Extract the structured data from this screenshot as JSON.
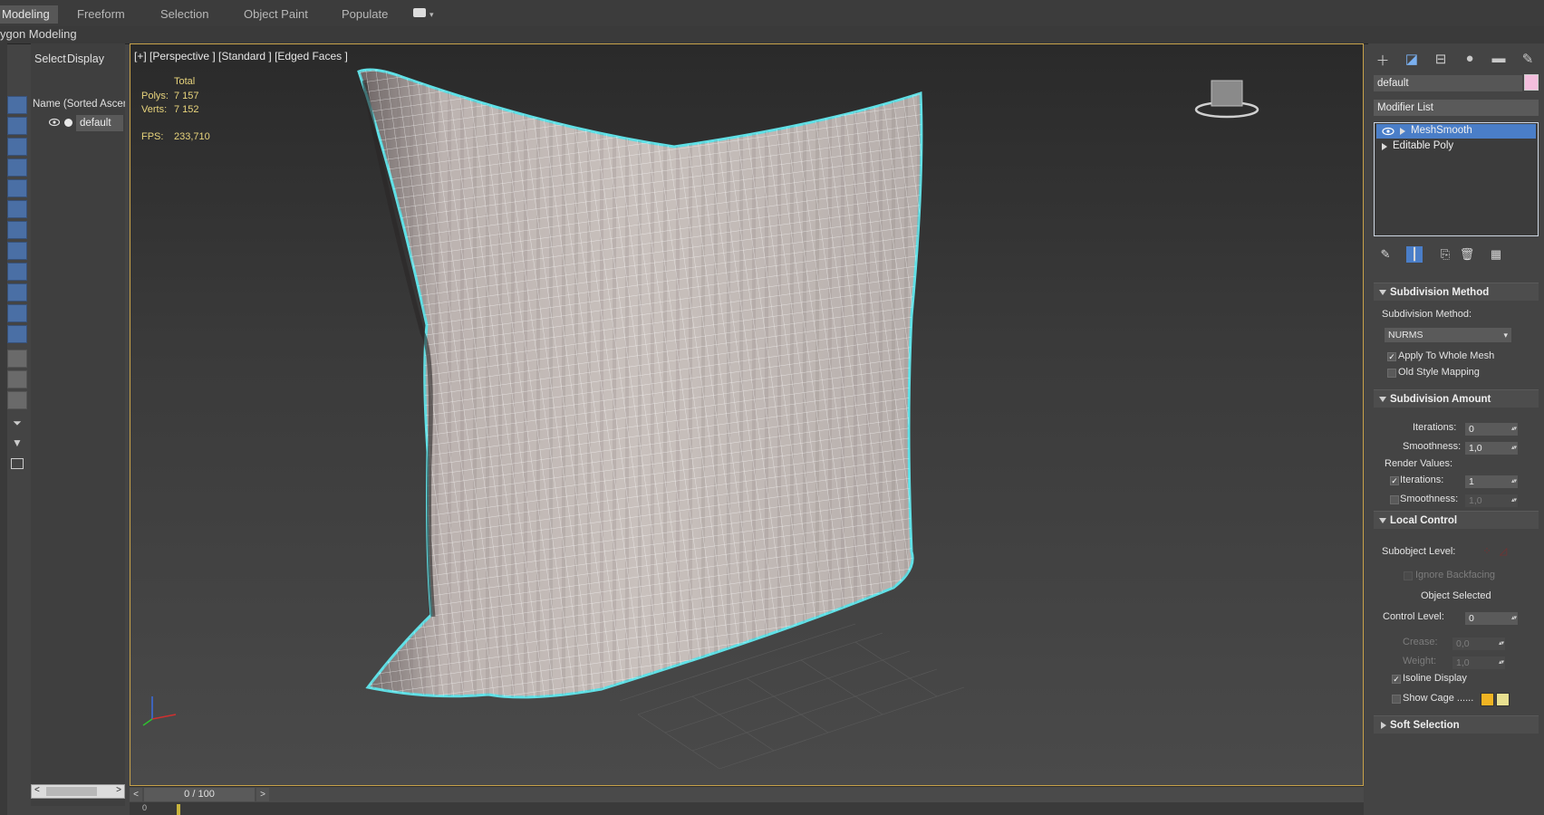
{
  "ribbon": {
    "tabs": [
      "Modeling",
      "Freeform",
      "Selection",
      "Object Paint",
      "Populate"
    ],
    "subtitle": "ygon Modeling"
  },
  "explorer": {
    "tab_select": "Select",
    "tab_display": "Display",
    "column_header": "Name (Sorted Ascending)",
    "objects": [
      {
        "name": "default"
      }
    ]
  },
  "viewport": {
    "label": "[+] [Perspective ] [Standard ] [Edged Faces ]",
    "stats": {
      "total_label": "Total",
      "polys_label": "Polys:",
      "polys_value": "7 157",
      "verts_label": "Verts:",
      "verts_value": "7 152",
      "fps_label": "FPS:",
      "fps_value": "233,710"
    }
  },
  "timeline": {
    "frame": "0 / 100",
    "ruler_start": "0"
  },
  "command_panel": {
    "object_name": "default",
    "object_color": "#f4bedd",
    "modifier_list": "Modifier List",
    "stack": [
      "MeshSmooth",
      "Editable Poly"
    ],
    "subdivision_method": {
      "title": "Subdivision Method",
      "method_label": "Subdivision Method:",
      "method_value": "NURMS",
      "apply_whole_mesh": "Apply To Whole Mesh",
      "old_style_mapping": "Old Style Mapping"
    },
    "subdivision_amount": {
      "title": "Subdivision Amount",
      "iterations_label": "Iterations:",
      "iterations_value": "0",
      "smoothness_label": "Smoothness:",
      "smoothness_value": "1,0",
      "render_values": "Render Values:",
      "r_iterations_label": "Iterations:",
      "r_iterations_value": "1",
      "r_smoothness_label": "Smoothness:",
      "r_smoothness_value": "1,0"
    },
    "local_control": {
      "title": "Local Control",
      "subobject_level": "Subobject Level:",
      "ignore_backfacing": "Ignore Backfacing",
      "object_selected": "Object Selected",
      "control_level_label": "Control Level:",
      "control_level_value": "0",
      "crease_label": "Crease:",
      "crease_value": "0,0",
      "weight_label": "Weight:",
      "weight_value": "1,0",
      "isoline_display": "Isoline Display",
      "show_cage": "Show Cage ......",
      "cage_colors": [
        "#f0b423",
        "#e8e090"
      ]
    },
    "soft_selection": {
      "title": "Soft Selection"
    }
  }
}
